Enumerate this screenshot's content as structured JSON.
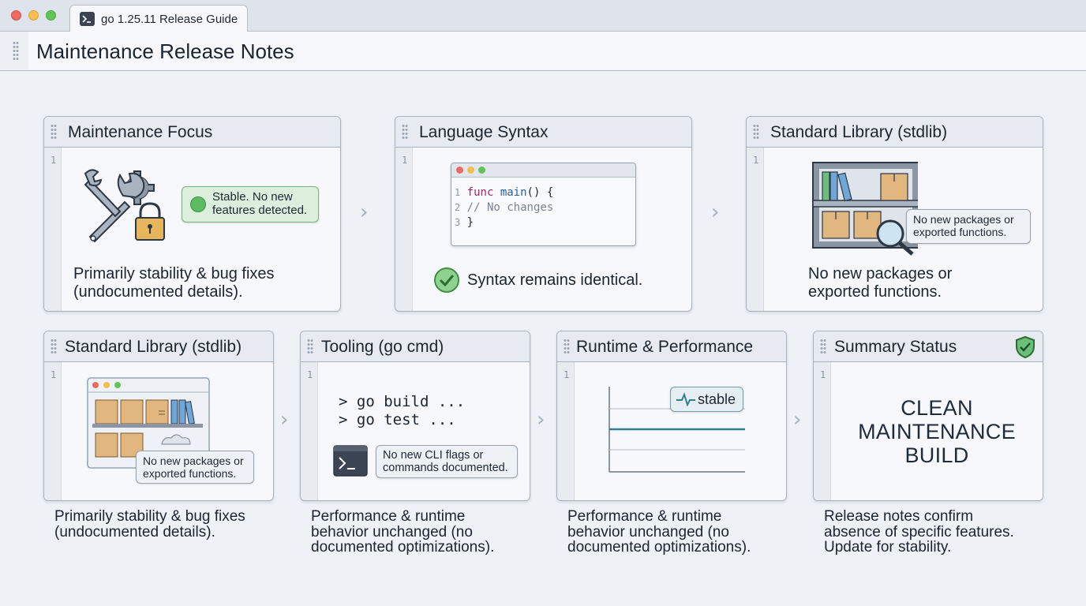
{
  "window": {
    "tab_title": "go 1.25.11 Release Guide",
    "page_title": "Maintenance Release Notes"
  },
  "colors": {
    "accent_green": "#5dbb63",
    "chart_line": "#2f7f8f",
    "background": "#eef1f6"
  },
  "cards": {
    "maintenance_focus": {
      "title": "Maintenance Focus",
      "line": "1",
      "callout": "Stable. No new features detected.",
      "text_1": "Primarily stability & bug fixes",
      "text_2": "(undocumented details)."
    },
    "language_syntax": {
      "title": "Language Syntax",
      "line": "1",
      "code_lines": [
        "1",
        "2",
        "3"
      ],
      "code_1_kw": "func",
      "code_1_name": "main",
      "code_1_rest": "() {",
      "code_2": "// No changes",
      "code_3": "}",
      "status": "Syntax remains identical."
    },
    "stdlib_top": {
      "title": "Standard Library (stdlib)",
      "line": "1",
      "callout_1": "No new packages or",
      "callout_2": "exported functions.",
      "text_1": "No new packages or",
      "text_2": "exported functions."
    },
    "stdlib_bottom": {
      "title": "Standard Library (stdlib)",
      "line": "1",
      "callout_1": "No new packages or",
      "callout_2": "exported functions.",
      "below_1": "Primarily stability & bug fixes",
      "below_2": "(undocumented details)."
    },
    "tooling": {
      "title_main": "Tooling",
      "title_sub": "(go cmd)",
      "line": "1",
      "cmd_1": "> go build ...",
      "cmd_2": "> go test ...",
      "callout_1": "No new CLI flags or",
      "callout_2": "commands documented.",
      "below_1": "Performance & runtime",
      "below_2": "behavior unchanged (no",
      "below_3": "documented optimizations)."
    },
    "runtime": {
      "title": "Runtime & Performance",
      "line": "1",
      "badge": "stable",
      "below_1": "Performance & runtime",
      "below_2": "behavior unchanged (no",
      "below_3": "documented optimizations)."
    },
    "summary": {
      "title": "Summary Status",
      "line": "1",
      "status_1": "CLEAN",
      "status_2": "MAINTENANCE",
      "status_3": "BUILD",
      "below_1": "Release notes confirm",
      "below_2": "absence of specific features.",
      "below_3": "Update for stability."
    }
  },
  "icons": {
    "tab": "terminal-icon",
    "card1": "wrench-gear-lock-icon",
    "card2_status": "check-circle-icon",
    "card3": "bookshelf-magnifier-icon",
    "card4": "browser-shelf-icon",
    "card5": "terminal-icon",
    "card6": "pulse-icon",
    "card7": "shield-check-icon",
    "arrow": "chevron-right-icon"
  }
}
